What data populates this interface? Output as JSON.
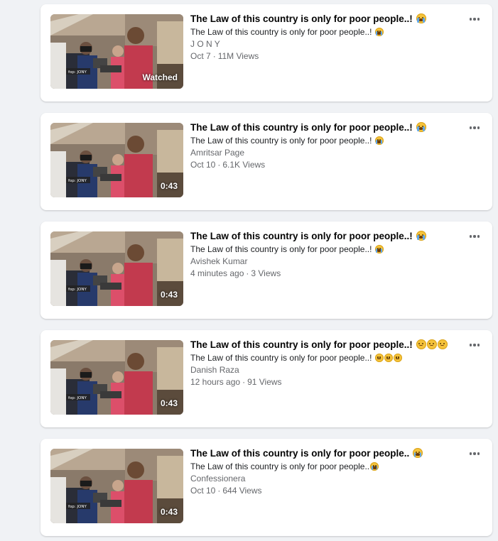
{
  "badges": {
    "watched": "Watched",
    "duration": "0:43"
  },
  "meta_separator": "·",
  "thumbnail_caption": "fop: JONY",
  "videos": [
    {
      "title": "The Law of this country is only for poor people..!",
      "title_emojis": [
        "loudly-crying-face"
      ],
      "description": "The Law of this country is only for poor people..!",
      "description_emojis": [
        "loudly-crying-face"
      ],
      "author": "J O N Y",
      "date": "Oct 7",
      "views": "11M Views",
      "badge": "Watched"
    },
    {
      "title": "The Law of this country is only for poor people..!",
      "title_emojis": [
        "loudly-crying-face"
      ],
      "description": "The Law of this country is only for poor people..!",
      "description_emojis": [
        "loudly-crying-face"
      ],
      "author": "Amritsar Page",
      "date": "Oct 10",
      "views": "6.1K Views",
      "badge": "0:43"
    },
    {
      "title": "The Law of this country is only for poor people..!",
      "title_emojis": [
        "loudly-crying-face"
      ],
      "description": "The Law of this country is only for poor people..!",
      "description_emojis": [
        "loudly-crying-face"
      ],
      "author": "Avishek Kumar",
      "date": "4 minutes ago",
      "views": "3 Views",
      "badge": "0:43"
    },
    {
      "title": "The Law of this country is only for poor people..!",
      "title_emojis": [
        "sad-face",
        "sad-face",
        "sad-face"
      ],
      "description": "The Law of this country is only for poor people..!",
      "description_emojis": [
        "sad-face",
        "sad-face",
        "sad-face"
      ],
      "author": "Danish Raza",
      "date": "12 hours ago",
      "views": "91 Views",
      "badge": "0:43"
    },
    {
      "title": "The Law of this country is only for poor people..",
      "title_emojis": [
        "loudly-crying-face"
      ],
      "description": "The Law of this country is only for poor people..",
      "description_emojis": [
        "loudly-crying-face"
      ],
      "author": "Confessionera",
      "date": "Oct 10",
      "views": "644 Views",
      "badge": "0:43"
    }
  ],
  "more_icon": "three-dots-horizontal-icon"
}
